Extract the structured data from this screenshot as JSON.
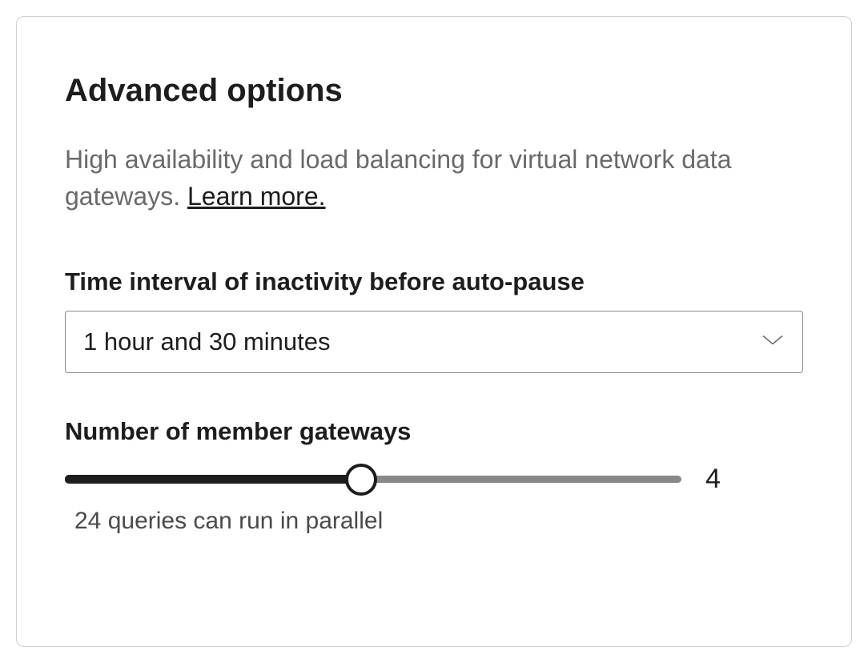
{
  "section": {
    "title": "Advanced options",
    "description_prefix": "High availability and load balancing for virtual network data gateways. ",
    "learn_more_label": "Learn more."
  },
  "autopause": {
    "label": "Time interval of inactivity before auto-pause",
    "selected": "1 hour and 30 minutes"
  },
  "gateways": {
    "label": "Number of member gateways",
    "value": "4",
    "helper": "24 queries can run in parallel"
  }
}
